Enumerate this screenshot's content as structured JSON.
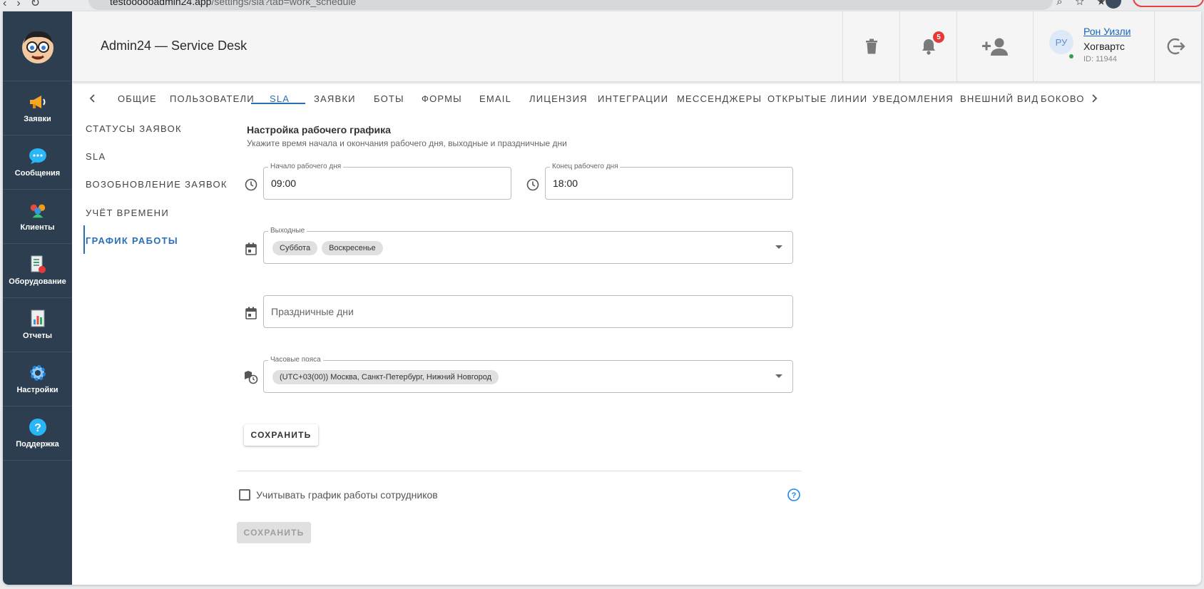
{
  "browser": {
    "url_host": "testoooooadmin24.app",
    "url_path": "/settings/sla?tab=work_schedule"
  },
  "sidebar": {
    "items": [
      {
        "label": "Заявки",
        "icon": "megaphone-icon"
      },
      {
        "label": "Сообщения",
        "icon": "chat-bubble-icon"
      },
      {
        "label": "Клиенты",
        "icon": "people-icon"
      },
      {
        "label": "Оборудование",
        "icon": "equipment-icon"
      },
      {
        "label": "Отчеты",
        "icon": "report-icon"
      },
      {
        "label": "Настройки",
        "icon": "gear-icon"
      },
      {
        "label": "Поддержка",
        "icon": "help-icon"
      }
    ]
  },
  "header": {
    "title": "Admin24 — Service Desk",
    "notifications_count": "5",
    "user": {
      "initials": "РУ",
      "name": "Рон Уизли",
      "org": "Хогвартс",
      "id": "ID: 11944"
    }
  },
  "tabs": [
    {
      "label": "ОБЩИЕ"
    },
    {
      "label": "ПОЛЬЗОВАТЕЛИ"
    },
    {
      "label": "SLA"
    },
    {
      "label": "ЗАЯВКИ"
    },
    {
      "label": "БОТЫ"
    },
    {
      "label": "ФОРМЫ"
    },
    {
      "label": "EMAIL"
    },
    {
      "label": "ЛИЦЕНЗИЯ"
    },
    {
      "label": "ИНТЕГРАЦИИ"
    },
    {
      "label": "МЕССЕНДЖЕРЫ"
    },
    {
      "label": "ОТКРЫТЫЕ ЛИНИИ"
    },
    {
      "label": "УВЕДОМЛЕНИЯ"
    },
    {
      "label": "ВНЕШНИЙ ВИД"
    },
    {
      "label": "БОКОВОЕ"
    }
  ],
  "side_menu": [
    {
      "label": "СТАТУСЫ ЗАЯВОК"
    },
    {
      "label": "SLA"
    },
    {
      "label": "ВОЗОБНОВЛЕНИЕ ЗАЯВОК"
    },
    {
      "label": "УЧЁТ ВРЕМЕНИ"
    },
    {
      "label": "ГРАФИК РАБОТЫ"
    }
  ],
  "form": {
    "title": "Настройка рабочего графика",
    "subtitle": "Укажите время начала и окончания рабочего дня, выходные и праздничные дни",
    "start": {
      "label": "Начало рабочего дня",
      "value": "09:00"
    },
    "end": {
      "label": "Конец рабочего дня",
      "value": "18:00"
    },
    "weekends": {
      "label": "Выходные",
      "chips": [
        "Суббота",
        "Воскресенье"
      ]
    },
    "holidays": {
      "placeholder": "Праздничные дни"
    },
    "timezone": {
      "label": "Часовые пояса",
      "chip": "(UTC+03(00)) Москва, Санкт-Петербург, Нижний Новгород"
    },
    "save_label": "СОХРАНИТЬ",
    "employee_schedule_label": "Учитывать график работы сотрудников",
    "save2_label": "СОХРАНИТЬ"
  }
}
